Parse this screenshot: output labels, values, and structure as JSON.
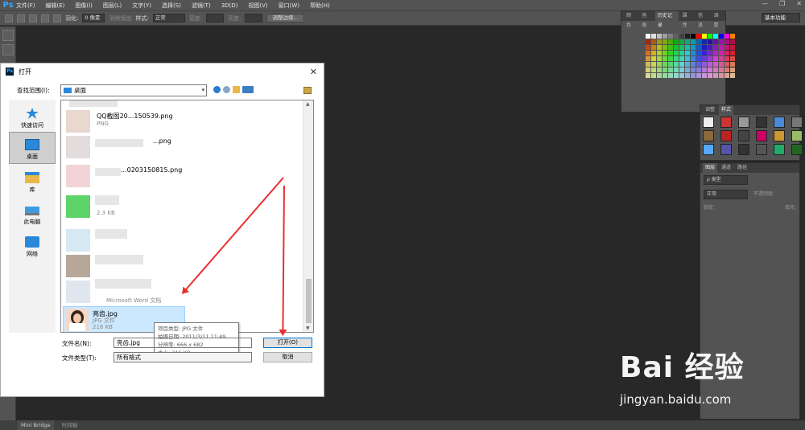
{
  "app": {
    "logo": "Ps",
    "menu": [
      "文件(F)",
      "编辑(E)",
      "图像(I)",
      "图层(L)",
      "文字(Y)",
      "选择(S)",
      "滤镜(T)",
      "3D(D)",
      "视图(V)",
      "窗口(W)",
      "帮助(H)"
    ],
    "window_controls": [
      "—",
      "❐",
      "✕"
    ],
    "options": {
      "feather_label": "羽化:",
      "feather_value": "0 像素",
      "antialias_label": "消除锯齿",
      "style_label": "样式:",
      "style_value": "正常",
      "width_label": "宽度:",
      "height_label": "高度:",
      "refine_button": "调整边缘..."
    },
    "workspace": "基本功能",
    "bottom_tabs": [
      "Mini Bridge",
      "时间轴"
    ]
  },
  "panels": {
    "color_tabs": [
      "颜色",
      "色板",
      "历史记录",
      "属性",
      "信息",
      "调整"
    ],
    "style_tabs": [
      "调整",
      "样式"
    ],
    "layers_tabs": [
      "图层",
      "通道",
      "路径"
    ],
    "layers": {
      "kind": "ρ 类型",
      "blend": "正常",
      "opacity_label": "不透明度:",
      "lock_label": "锁定:",
      "fill_label": "填充:"
    }
  },
  "dialog": {
    "title": "打开",
    "close": "✕",
    "look_in_label": "查找范围(I):",
    "look_in_value": "桌面",
    "places": [
      {
        "label": "快速访问",
        "icon": "star-icon",
        "selected": false
      },
      {
        "label": "桌面",
        "icon": "desktop-icon",
        "selected": true
      },
      {
        "label": "库",
        "icon": "library-icon",
        "selected": false
      },
      {
        "label": "此电脑",
        "icon": "computer-icon",
        "selected": false
      },
      {
        "label": "网络",
        "icon": "network-icon",
        "selected": false
      }
    ],
    "files": [
      {
        "name": "QQ截图20...150539.png",
        "sub": "PNG"
      },
      {
        "name": "...png",
        "sub": ""
      },
      {
        "name": "...0203150815.png",
        "sub": ""
      },
      {
        "name": "",
        "sub": "2.3 KB"
      },
      {
        "name": "",
        "sub": "Microsoft Word 文档"
      }
    ],
    "selected_file": {
      "name": "亮齿.jpg",
      "type": "JPG 文件",
      "size": "216 KB"
    },
    "tooltip": [
      "项目类型: JPG 文件",
      "拍摄日期: 2011/3/11 11:49",
      "分辨率: 666 x 682",
      "大小: 216 KB"
    ],
    "filename_label": "文件名(N):",
    "filename_value": "亮齿.jpg",
    "filetype_label": "文件类型(T):",
    "filetype_value": "所有格式",
    "open_button": "打开(O)",
    "cancel_button": "取消"
  },
  "watermark": {
    "logo": "Bai 经验",
    "url": "jingyan.baidu.com"
  },
  "colors": {
    "ps_gray": "#535353",
    "canvas": "#282828",
    "arrow": "#e8302f",
    "selection": "#cce8ff"
  }
}
